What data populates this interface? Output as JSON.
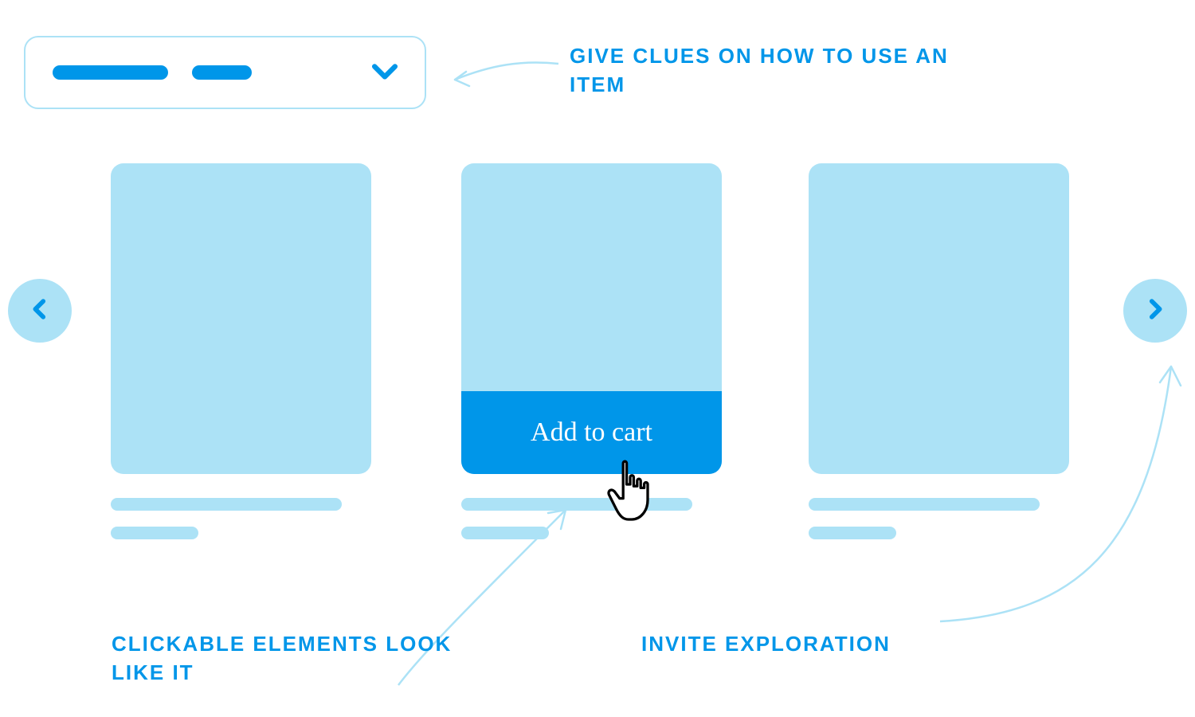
{
  "dropdown": {
    "chevron_icon": "chevron-down"
  },
  "carousel": {
    "prev_icon": "chevron-left",
    "next_icon": "chevron-right",
    "cards": [
      {
        "cta_visible": false
      },
      {
        "cta_visible": true,
        "cta_label": "Add to cart"
      },
      {
        "cta_visible": false
      }
    ]
  },
  "annotations": {
    "clue": "GIVE CLUES ON HOW TO USE AN ITEM",
    "click": "CLICKABLE ELEMENTS LOOK LIKE IT",
    "invite": "INVITE EXPLORATION"
  },
  "colors": {
    "accent": "#0096e9",
    "tint": "#ACE2F6"
  }
}
